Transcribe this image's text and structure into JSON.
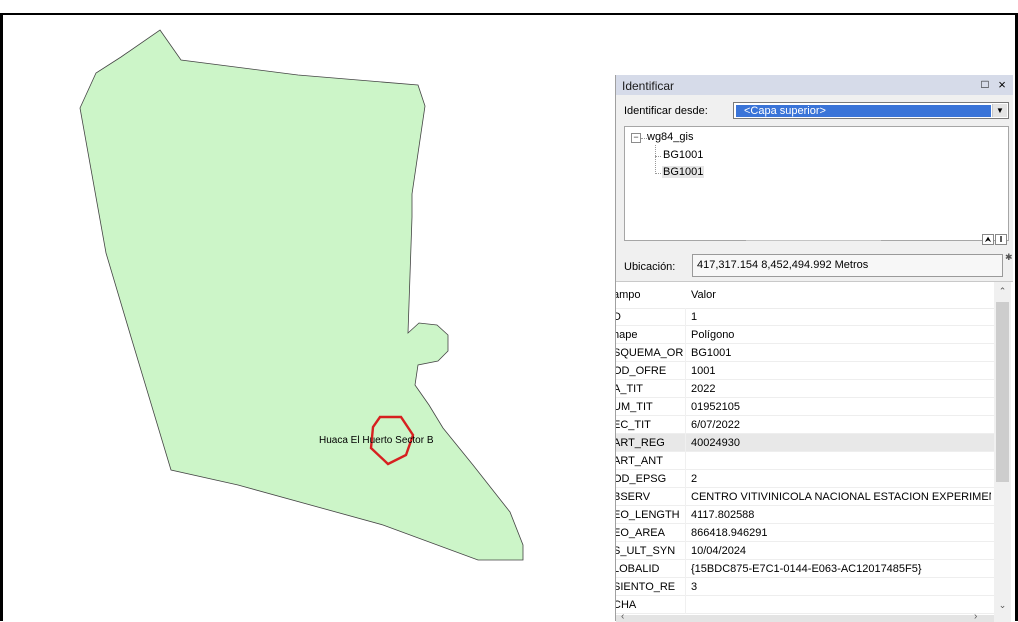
{
  "colors": {
    "polygon_fill": "#ccf5c8",
    "polygon_stroke": "#444444",
    "selection_outline": "#d62020",
    "dropdown_highlight": "#3a74d8",
    "panel_titlebar": "#d6dbe9"
  },
  "map": {
    "feature_label": "Huaca El Huerto Sector B"
  },
  "identify": {
    "title": "Identificar",
    "restore_icon": "□",
    "close_icon": "×",
    "from_label": "Identificar desde:",
    "from_value": "<Capa superior>",
    "tree": {
      "root": "wg84_gis",
      "children": [
        "BG1001",
        "BG1001"
      ]
    },
    "location_label": "Ubicación:",
    "location_value": "417,317.154  8,452,494.992 Metros",
    "columns": {
      "field": "ampo",
      "value": "Valor"
    },
    "rows": [
      {
        "field": "D",
        "value": "1"
      },
      {
        "field": "hape",
        "value": "Polígono"
      },
      {
        "field": "SQUEMA_OR",
        "value": "BG1001"
      },
      {
        "field": "OD_OFRE",
        "value": "1001"
      },
      {
        "field": "A_TIT",
        "value": "2022"
      },
      {
        "field": "UM_TIT",
        "value": "01952105"
      },
      {
        "field": "EC_TIT",
        "value": "6/07/2022"
      },
      {
        "field": "ART_REG",
        "value": "40024930"
      },
      {
        "field": "ART_ANT",
        "value": ""
      },
      {
        "field": "OD_EPSG",
        "value": "2"
      },
      {
        "field": "BSERV",
        "value": "CENTRO VITIVINICOLA NACIONAL ESTACION EXPERIMEN."
      },
      {
        "field": "EO_LENGTH",
        "value": "4117.802588"
      },
      {
        "field": "EO_AREA",
        "value": "866418.946291"
      },
      {
        "field": "S_ULT_SYN",
        "value": "10/04/2024"
      },
      {
        "field": "LOBALID",
        "value": "{15BDC875-E7C1-0144-E063-AC12017485F5}"
      },
      {
        "field": "SIENTO_RE",
        "value": "3"
      },
      {
        "field": "CHA",
        "value": ""
      }
    ]
  }
}
